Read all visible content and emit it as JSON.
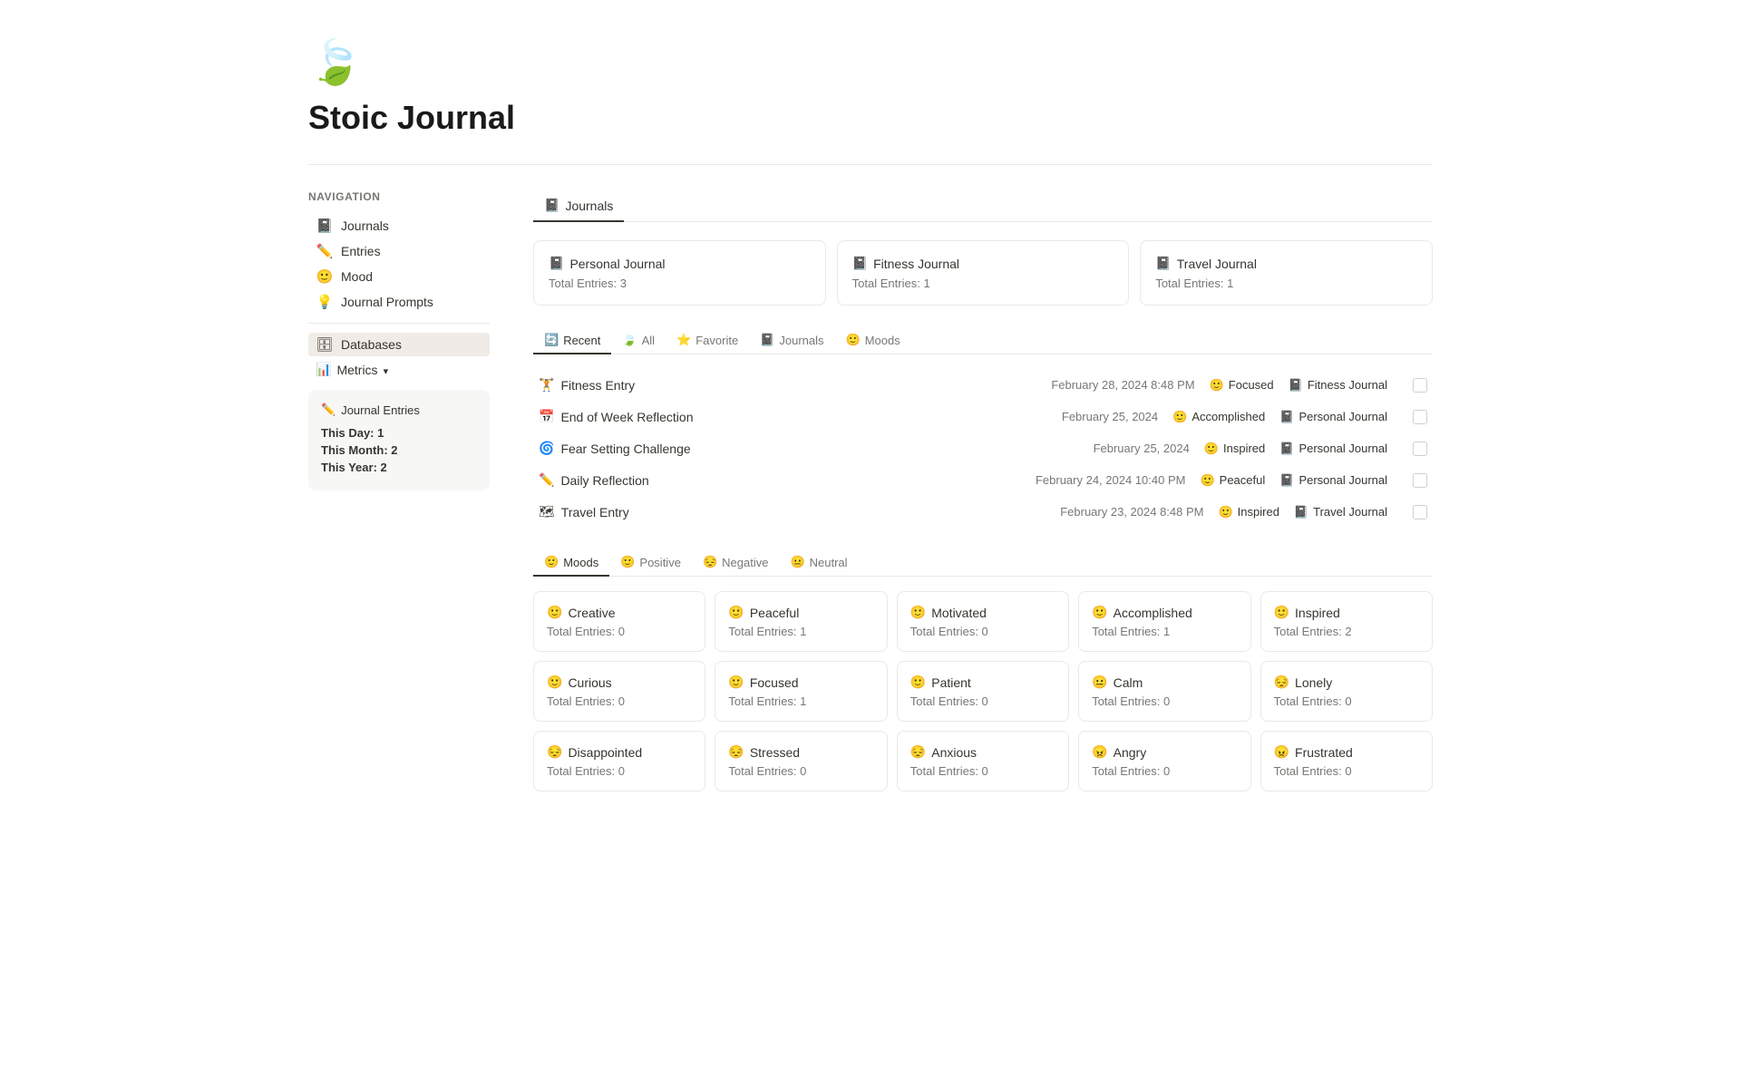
{
  "app": {
    "title": "Stoic Journal",
    "logo": "🍃"
  },
  "sidebar": {
    "heading": "Navigation",
    "nav_items": [
      {
        "id": "journals",
        "label": "Journals",
        "icon": "📓"
      },
      {
        "id": "entries",
        "label": "Entries",
        "icon": "✏️"
      },
      {
        "id": "mood",
        "label": "Mood",
        "icon": "🙂"
      },
      {
        "id": "journal-prompts",
        "label": "Journal Prompts",
        "icon": "💡"
      }
    ],
    "databases_label": "Databases",
    "metrics_label": "Metrics",
    "metrics_card": {
      "title": "Journal Entries",
      "icon": "✏️",
      "this_day_label": "This Day:",
      "this_day_value": "1",
      "this_month_label": "This Month:",
      "this_month_value": "2",
      "this_year_label": "This Year:",
      "this_year_value": "2"
    }
  },
  "content": {
    "section_heading": "Journals",
    "section_icon": "📓",
    "journals": [
      {
        "title": "Personal Journal",
        "icon": "📓",
        "total_entries_label": "Total Entries:",
        "total_entries_value": "3"
      },
      {
        "title": "Fitness Journal",
        "icon": "📓",
        "total_entries_label": "Total Entries:",
        "total_entries_value": "1"
      },
      {
        "title": "Travel Journal",
        "icon": "📓",
        "total_entries_label": "Total Entries:",
        "total_entries_value": "1"
      }
    ],
    "entries_tabs": [
      {
        "id": "recent",
        "label": "Recent",
        "icon": "🔄",
        "active": true
      },
      {
        "id": "all",
        "label": "All",
        "icon": "🍃"
      },
      {
        "id": "favorite",
        "label": "Favorite",
        "icon": "⭐"
      },
      {
        "id": "journals",
        "label": "Journals",
        "icon": "📓"
      },
      {
        "id": "moods",
        "label": "Moods",
        "icon": "🙂"
      }
    ],
    "entries": [
      {
        "title": "Fitness Entry",
        "icon": "🏋",
        "date": "February 28, 2024 8:48 PM",
        "mood": "Focused",
        "mood_icon": "🙂",
        "journal": "Fitness Journal",
        "journal_icon": "📓"
      },
      {
        "title": "End of Week Reflection",
        "icon": "📅",
        "date": "February 25, 2024",
        "mood": "Accomplished",
        "mood_icon": "🙂",
        "journal": "Personal Journal",
        "journal_icon": "📓"
      },
      {
        "title": "Fear Setting Challenge",
        "icon": "🌀",
        "date": "February 25, 2024",
        "mood": "Inspired",
        "mood_icon": "🙂",
        "journal": "Personal Journal",
        "journal_icon": "📓"
      },
      {
        "title": "Daily Reflection",
        "icon": "✏️",
        "date": "February 24, 2024 10:40 PM",
        "mood": "Peaceful",
        "mood_icon": "🙂",
        "journal": "Personal Journal",
        "journal_icon": "📓"
      },
      {
        "title": "Travel Entry",
        "icon": "🗺",
        "date": "February 23, 2024 8:48 PM",
        "mood": "Inspired",
        "mood_icon": "🙂",
        "journal": "Travel Journal",
        "journal_icon": "📓"
      }
    ],
    "moods_tabs": [
      {
        "id": "moods",
        "label": "Moods",
        "icon": "🙂",
        "active": true
      },
      {
        "id": "positive",
        "label": "Positive",
        "icon": "🙂"
      },
      {
        "id": "negative",
        "label": "Negative",
        "icon": "😔"
      },
      {
        "id": "neutral",
        "label": "Neutral",
        "icon": "😐"
      }
    ],
    "moods": [
      {
        "title": "Creative",
        "icon": "🙂",
        "count_label": "Total Entries:",
        "count": "0"
      },
      {
        "title": "Peaceful",
        "icon": "🙂",
        "count_label": "Total Entries:",
        "count": "1"
      },
      {
        "title": "Motivated",
        "icon": "🙂",
        "count_label": "Total Entries:",
        "count": "0"
      },
      {
        "title": "Accomplished",
        "icon": "🙂",
        "count_label": "Total Entries:",
        "count": "1"
      },
      {
        "title": "Inspired",
        "icon": "🙂",
        "count_label": "Total Entries:",
        "count": "2"
      },
      {
        "title": "Curious",
        "icon": "🙂",
        "count_label": "Total Entries:",
        "count": "0"
      },
      {
        "title": "Focused",
        "icon": "🙂",
        "count_label": "Total Entries:",
        "count": "1"
      },
      {
        "title": "Patient",
        "icon": "🙂",
        "count_label": "Total Entries:",
        "count": "0"
      },
      {
        "title": "Calm",
        "icon": "😐",
        "count_label": "Total Entries:",
        "count": "0"
      },
      {
        "title": "Lonely",
        "icon": "😔",
        "count_label": "Total Entries:",
        "count": "0"
      },
      {
        "title": "Disappointed",
        "icon": "😔",
        "count_label": "Total Entries:",
        "count": "0"
      },
      {
        "title": "Stressed",
        "icon": "😔",
        "count_label": "Total Entries:",
        "count": "0"
      },
      {
        "title": "Anxious",
        "icon": "😔",
        "count_label": "Total Entries:",
        "count": "0"
      },
      {
        "title": "Angry",
        "icon": "😠",
        "count_label": "Total Entries:",
        "count": "0"
      },
      {
        "title": "Frustrated",
        "icon": "😠",
        "count_label": "Total Entries:",
        "count": "0"
      }
    ]
  }
}
